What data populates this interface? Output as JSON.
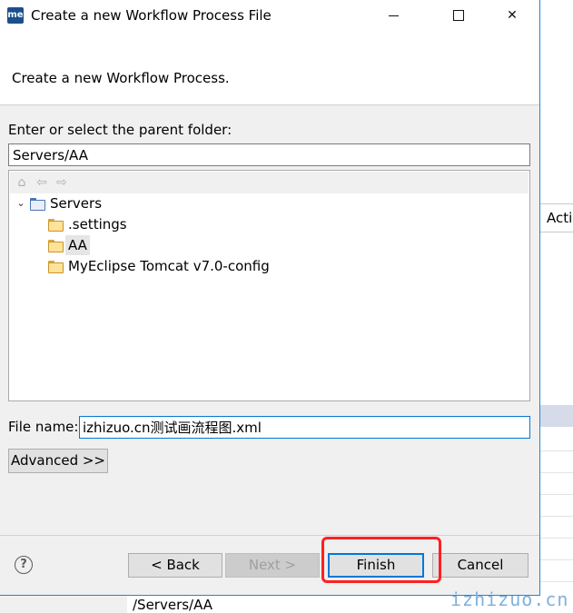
{
  "window": {
    "app_icon_text": "me",
    "title": "Create a new Workflow Process File"
  },
  "header": {
    "message": "Create a new Workflow Process."
  },
  "folder": {
    "label": "Enter or select the parent folder:",
    "value": "Servers/AA"
  },
  "tree": {
    "toolbar_icons": [
      "home-icon",
      "back-arrow-icon",
      "forward-arrow-icon"
    ],
    "items": [
      {
        "label": "Servers",
        "expanded": true,
        "level": 0
      },
      {
        "label": ".settings",
        "level": 1
      },
      {
        "label": "AA",
        "level": 1,
        "selected": true
      },
      {
        "label": "MyEclipse Tomcat v7.0-config",
        "level": 1
      }
    ]
  },
  "file": {
    "label": "File name:",
    "value": "izhizuo.cn测试画流程图.xml"
  },
  "buttons": {
    "advanced": "Advanced >>",
    "back": "< Back",
    "next": "Next >",
    "finish": "Finish",
    "cancel": "Cancel"
  },
  "background": {
    "tab_label": "Acti",
    "path_text": "/Servers/AA",
    "watermark": "izhizuo.cn"
  },
  "colors": {
    "accent": "#0078d7",
    "highlight": "#ff2020"
  }
}
